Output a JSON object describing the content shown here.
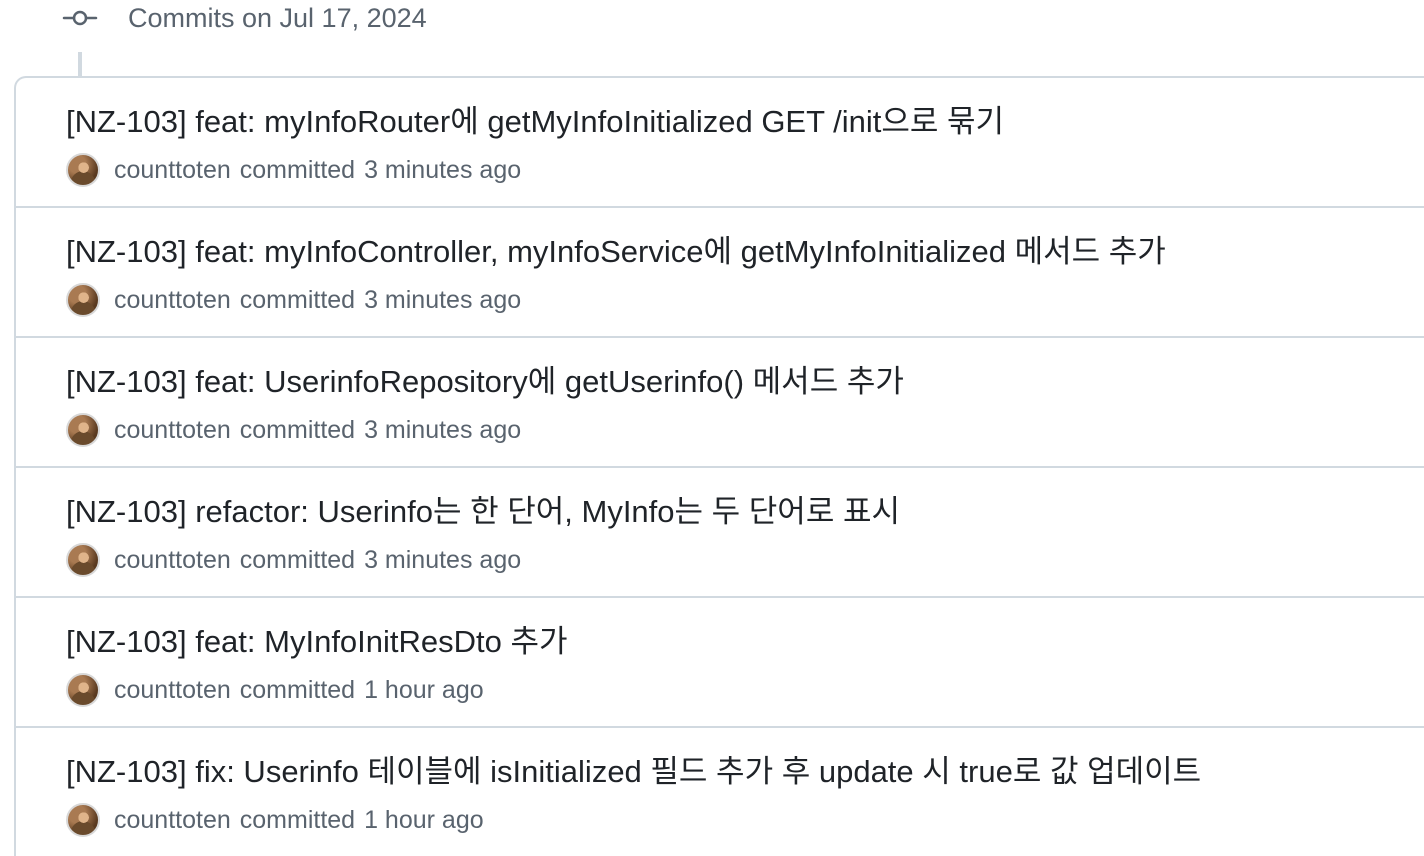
{
  "group": {
    "title": "Commits on Jul 17, 2024",
    "icon": "git-commit-icon"
  },
  "commits": [
    {
      "title": "[NZ-103] feat: myInfoRouter에 getMyInfoInitialized GET /init으로 묶기",
      "author": "counttoten",
      "verb": "committed",
      "time": "3 minutes ago"
    },
    {
      "title": "[NZ-103] feat: myInfoController, myInfoService에 getMyInfoInitialized 메서드 추가",
      "author": "counttoten",
      "verb": "committed",
      "time": "3 minutes ago"
    },
    {
      "title": "[NZ-103] feat: UserinfoRepository에 getUserinfo() 메서드 추가",
      "author": "counttoten",
      "verb": "committed",
      "time": "3 minutes ago"
    },
    {
      "title": "[NZ-103] refactor: Userinfo는 한 단어, MyInfo는 두 단어로 표시",
      "author": "counttoten",
      "verb": "committed",
      "time": "3 minutes ago"
    },
    {
      "title": "[NZ-103] feat: MyInfoInitResDto 추가",
      "author": "counttoten",
      "verb": "committed",
      "time": "1 hour ago"
    },
    {
      "title": "[NZ-103] fix: Userinfo 테이블에 isInitialized 필드 추가 후 update 시 true로 값 업데이트",
      "author": "counttoten",
      "verb": "committed",
      "time": "1 hour ago"
    }
  ],
  "colors": {
    "text": "#1f2328",
    "muted": "#59636e",
    "border": "#d1d9e0"
  }
}
